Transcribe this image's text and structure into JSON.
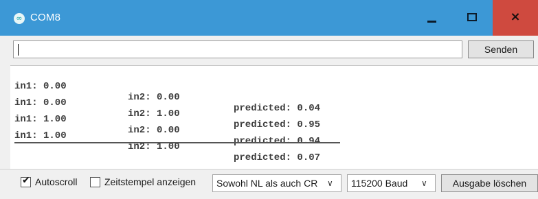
{
  "window": {
    "title": "COM8",
    "icon": "infinity-icon"
  },
  "titlebar_buttons": {
    "minimize": "minimize-icon",
    "maximize": "maximize-icon",
    "close": "×"
  },
  "send": {
    "input_value": "",
    "button_label": "Senden"
  },
  "output": {
    "lines": [
      {
        "in1": "in1: 0.00",
        "in2": "in2: 0.00",
        "predicted": "predicted: 0.04"
      },
      {
        "in1": "in1: 0.00",
        "in2": "in2: 1.00",
        "predicted": "predicted: 0.95"
      },
      {
        "in1": "in1: 1.00",
        "in2": "in2: 0.00",
        "predicted": "predicted: 0.94"
      },
      {
        "in1": "in1: 1.00",
        "in2": "in2: 1.00",
        "predicted": "predicted: 0.07"
      }
    ]
  },
  "bottom": {
    "autoscroll": {
      "label": "Autoscroll",
      "checked": true
    },
    "timestamp": {
      "label": "Zeitstempel anzeigen",
      "checked": false
    },
    "line_ending": {
      "value": "Sowohl NL als auch CR"
    },
    "baud": {
      "value": "115200 Baud"
    },
    "clear_label": "Ausgabe löschen"
  }
}
